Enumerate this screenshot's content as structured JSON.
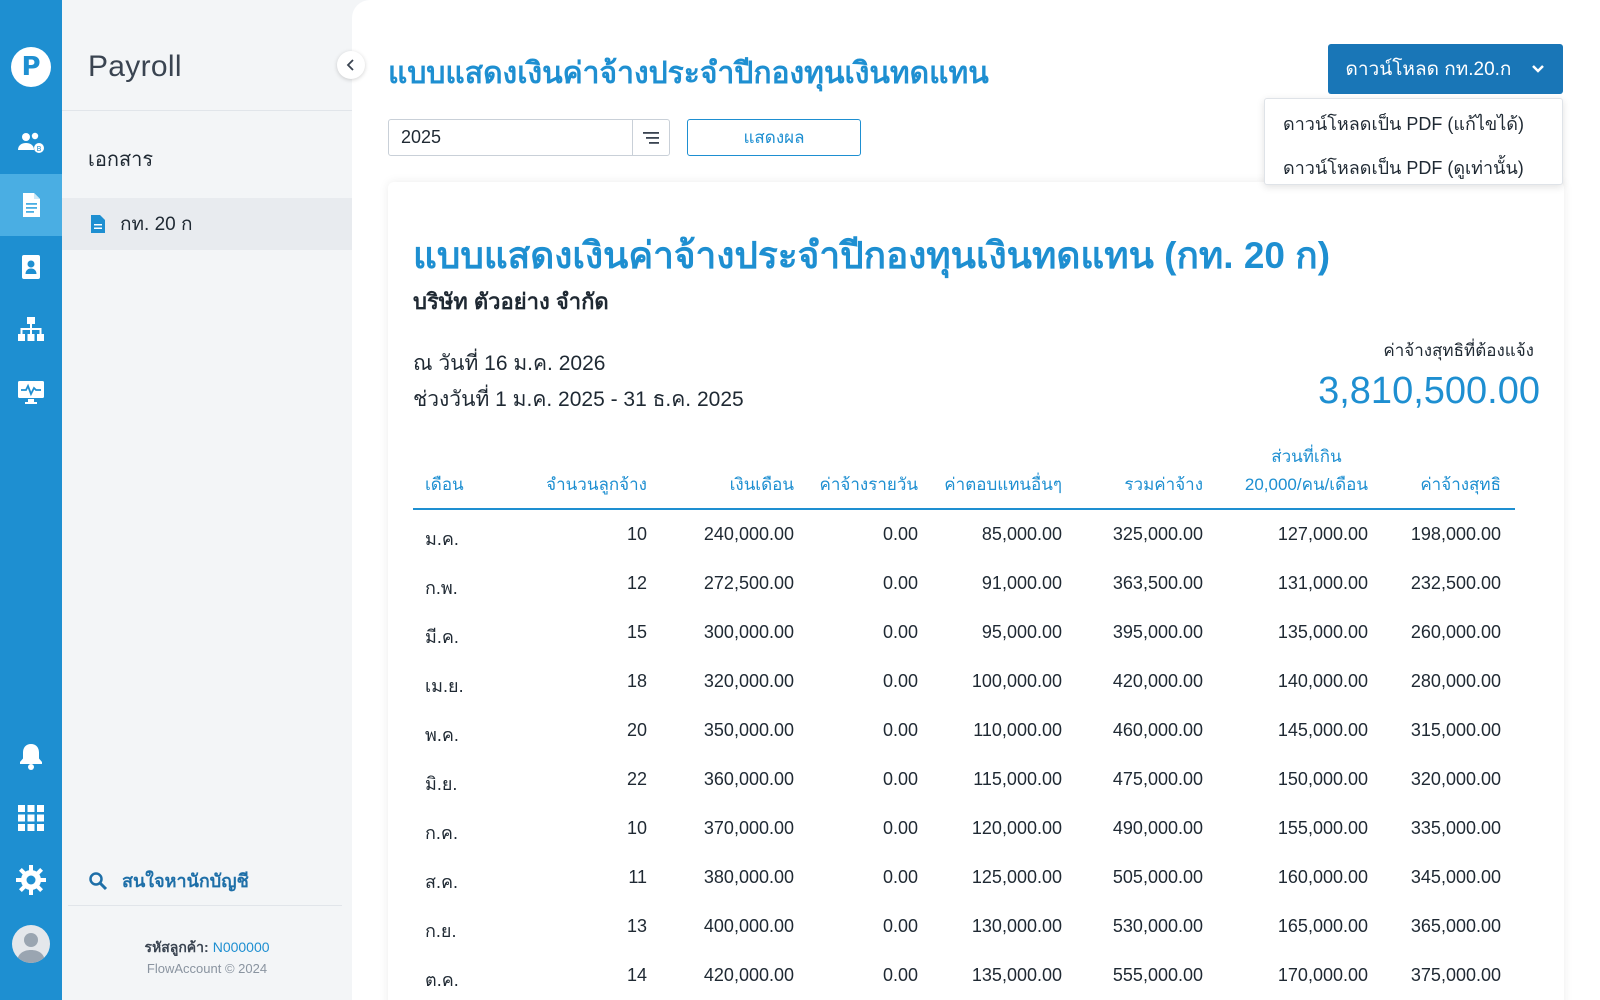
{
  "app": {
    "name": "Payroll"
  },
  "sidebar": {
    "section": "เอกสาร",
    "items": [
      {
        "label": "กท. 20 ก"
      }
    ],
    "help": "สนใจหานักบัญชี",
    "customer_code_label": "รหัสลูกค้า:",
    "customer_code": "N000000",
    "copyright": "FlowAccount © 2024"
  },
  "rail": {
    "icons": [
      "logo-icon",
      "employees-icon",
      "document-icon",
      "contact-card-icon",
      "org-chart-icon",
      "monitor-icon",
      "bell-icon",
      "apps-grid-icon",
      "gear-icon",
      "avatar"
    ]
  },
  "header": {
    "title": "แบบแสดงเงินค่าจ้างประจำปีกองทุนเงินทดแทน",
    "download_button": "ดาวน์โหลด กท.20.ก",
    "download_menu": [
      "ดาวน์โหลดเป็น PDF (แก้ไขได้)",
      "ดาวน์โหลดเป็น PDF (ดูเท่านั้น)"
    ]
  },
  "filter": {
    "year": "2025",
    "show_button": "แสดงผล"
  },
  "report": {
    "title": "แบบแสดงเงินค่าจ้างประจำปีกองทุนเงินทดแทน (กท. 20 ก)",
    "company": "บริษัท ตัวอย่าง จำกัด",
    "as_of": "ณ วันที่ 16 ม.ค. 2026",
    "period": "ช่วงวันที่ 1 ม.ค. 2025 - 31 ธ.ค. 2025",
    "net_label": "ค่าจ้างสุทธิที่ต้องแจ้ง",
    "net_value": "3,810,500.00",
    "columns": [
      "เดือน",
      "จำนวนลูกจ้าง",
      "เงินเดือน",
      "ค่าจ้างรายวัน",
      "ค่าตอบแทนอื่นๆ",
      "รวมค่าจ้าง",
      "ส่วนที่เกิน",
      "20,000/คน/เดือน",
      "ค่าจ้างสุทธิ"
    ],
    "rows": [
      [
        "ม.ค.",
        "10",
        "240,000.00",
        "0.00",
        "85,000.00",
        "325,000.00",
        "127,000.00",
        "198,000.00"
      ],
      [
        "ก.พ.",
        "12",
        "272,500.00",
        "0.00",
        "91,000.00",
        "363,500.00",
        "131,000.00",
        "232,500.00"
      ],
      [
        "มี.ค.",
        "15",
        "300,000.00",
        "0.00",
        "95,000.00",
        "395,000.00",
        "135,000.00",
        "260,000.00"
      ],
      [
        "เม.ย.",
        "18",
        "320,000.00",
        "0.00",
        "100,000.00",
        "420,000.00",
        "140,000.00",
        "280,000.00"
      ],
      [
        "พ.ค.",
        "20",
        "350,000.00",
        "0.00",
        "110,000.00",
        "460,000.00",
        "145,000.00",
        "315,000.00"
      ],
      [
        "มิ.ย.",
        "22",
        "360,000.00",
        "0.00",
        "115,000.00",
        "475,000.00",
        "150,000.00",
        "320,000.00"
      ],
      [
        "ก.ค.",
        "10",
        "370,000.00",
        "0.00",
        "120,000.00",
        "490,000.00",
        "155,000.00",
        "335,000.00"
      ],
      [
        "ส.ค.",
        "11",
        "380,000.00",
        "0.00",
        "125,000.00",
        "505,000.00",
        "160,000.00",
        "345,000.00"
      ],
      [
        "ก.ย.",
        "13",
        "400,000.00",
        "0.00",
        "130,000.00",
        "530,000.00",
        "165,000.00",
        "365,000.00"
      ],
      [
        "ต.ค.",
        "14",
        "420,000.00",
        "0.00",
        "135,000.00",
        "555,000.00",
        "170,000.00",
        "375,000.00"
      ]
    ]
  },
  "colors": {
    "primary": "#1e8fd1",
    "button": "#1976b7",
    "rail_active": "#4aaee3"
  }
}
